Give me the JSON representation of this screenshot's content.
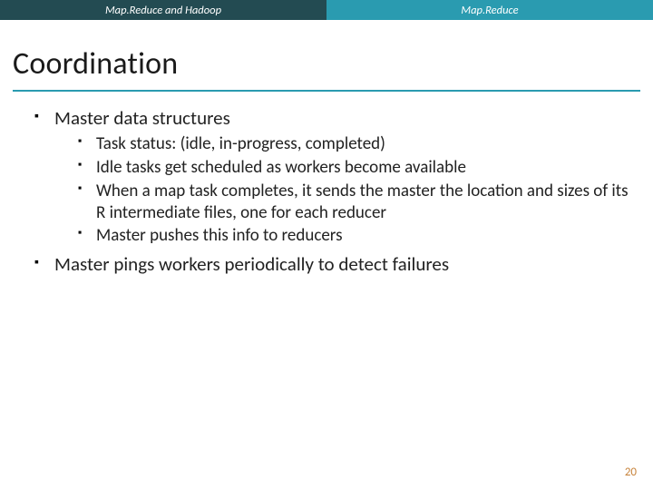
{
  "header": {
    "left_tab": "Map.Reduce and Hadoop",
    "right_tab": "Map.Reduce"
  },
  "title": "Coordination",
  "bullets": {
    "b1": "Master data structures",
    "b1_sub": {
      "s1": "Task status: (idle, in-progress, completed)",
      "s2": "Idle tasks get scheduled as workers become available",
      "s3": "When a map task completes, it sends the master the location and sizes of its R intermediate files, one for each reducer",
      "s4": "Master pushes this info to reducers"
    },
    "b2": "Master pings workers periodically to detect failures"
  },
  "page_number": "20"
}
